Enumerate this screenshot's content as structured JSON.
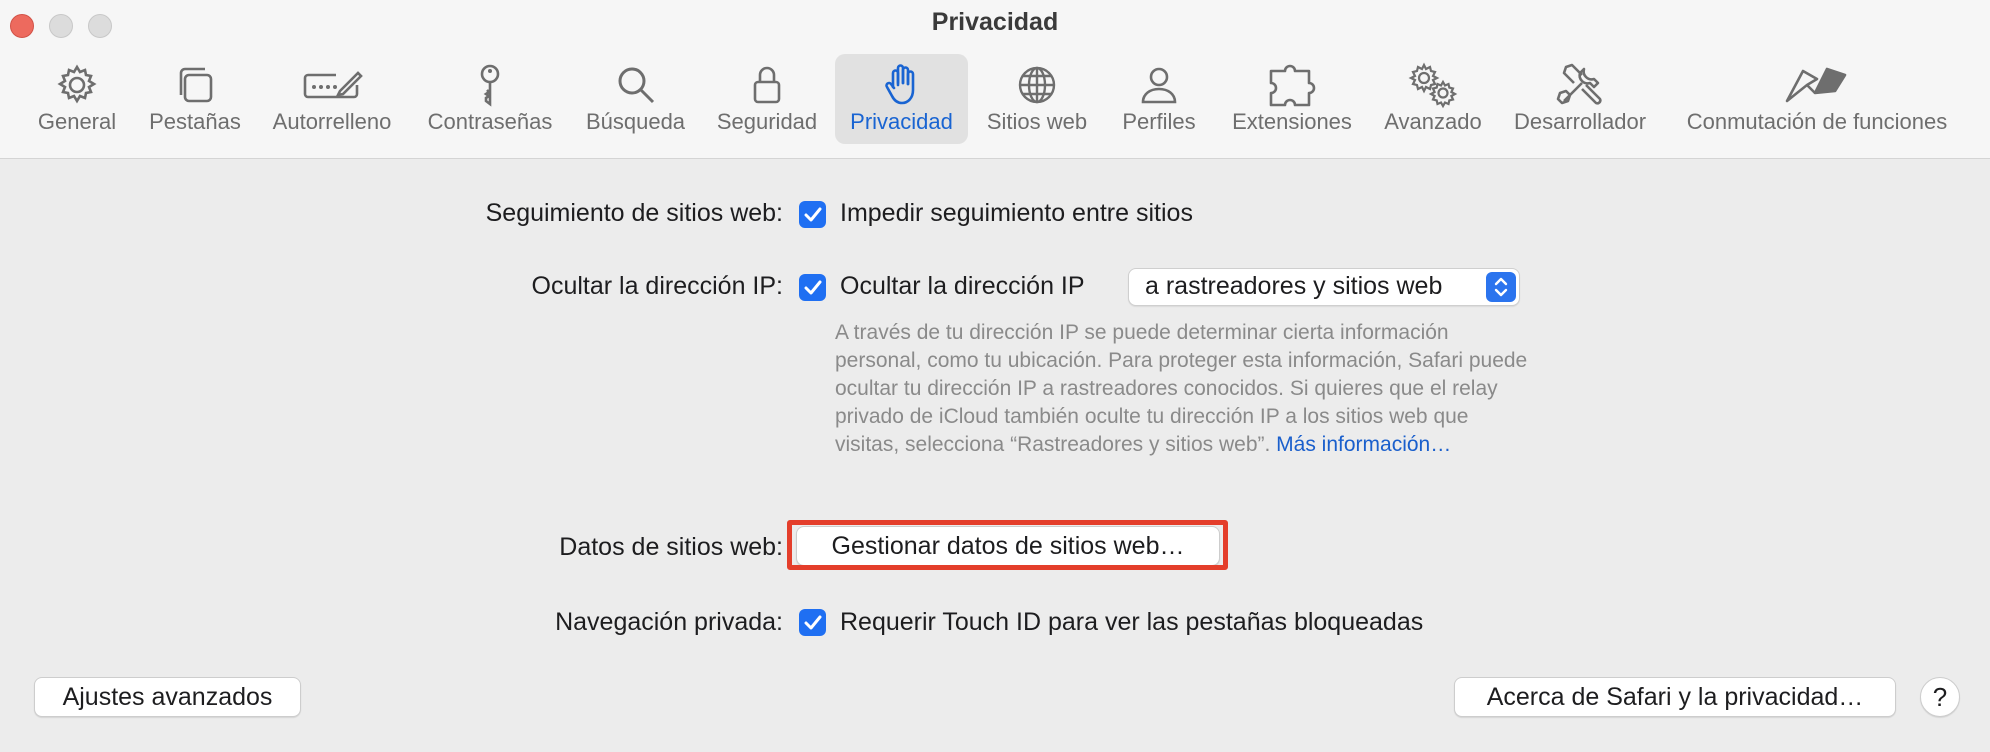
{
  "window": {
    "title": "Privacidad"
  },
  "toolbar": {
    "items": [
      {
        "label": "General",
        "icon": "gear-icon"
      },
      {
        "label": "Pestañas",
        "icon": "tabs-icon"
      },
      {
        "label": "Autorrelleno",
        "icon": "autofill-icon"
      },
      {
        "label": "Contraseñas",
        "icon": "key-icon"
      },
      {
        "label": "Búsqueda",
        "icon": "search-icon"
      },
      {
        "label": "Seguridad",
        "icon": "lock-icon"
      },
      {
        "label": "Privacidad",
        "icon": "hand-icon",
        "selected": true
      },
      {
        "label": "Sitios web",
        "icon": "globe-icon"
      },
      {
        "label": "Perfiles",
        "icon": "person-icon"
      },
      {
        "label": "Extensiones",
        "icon": "puzzle-icon"
      },
      {
        "label": "Avanzado",
        "icon": "gears-icon"
      },
      {
        "label": "Desarrollador",
        "icon": "tools-icon"
      },
      {
        "label": "Conmutación de funciones",
        "icon": "flags-icon"
      }
    ]
  },
  "settings": {
    "tracking": {
      "label": "Seguimiento de sitios web:",
      "checkbox_label": "Impedir seguimiento entre sitios",
      "checked": true
    },
    "hide_ip": {
      "label": "Ocultar la dirección IP:",
      "checkbox_label": "Ocultar la dirección IP",
      "checked": true,
      "selected_option": "a rastreadores y sitios web",
      "description": "A través de tu dirección IP se puede determinar cierta información personal, como tu ubicación. Para proteger esta información, Safari puede ocultar tu dirección IP a rastreadores conocidos. Si quieres que el relay privado de iCloud también oculte tu dirección IP a los sitios web que visitas, selecciona “Rastreadores y sitios web”. ",
      "link": "Más información…"
    },
    "website_data": {
      "label": "Datos de sitios web:",
      "button": "Gestionar datos de sitios web…"
    },
    "private_browsing": {
      "label": "Navegación privada:",
      "checkbox_label": "Requerir Touch ID para ver las pestañas bloqueadas",
      "checked": true
    }
  },
  "footer": {
    "advanced_button": "Ajustes avanzados",
    "about_button": "Acerca de Safari y la privacidad…",
    "help_button": "?"
  },
  "colors": {
    "accent": "#1f6ff2",
    "highlight": "#e43e2b",
    "link": "#1a5fcc"
  }
}
